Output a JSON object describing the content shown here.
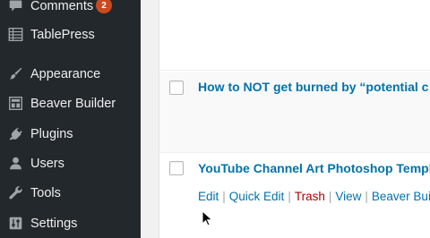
{
  "sidebar": {
    "items": [
      {
        "label": "Comments",
        "icon": "comment-bubble-icon",
        "badge": "2"
      },
      {
        "label": "TablePress",
        "icon": "table-icon"
      },
      {
        "label": "Appearance",
        "icon": "paintbrush-icon"
      },
      {
        "label": "Beaver Builder",
        "icon": "layout-grid-icon"
      },
      {
        "label": "Plugins",
        "icon": "plugin-plug-icon"
      },
      {
        "label": "Users",
        "icon": "user-icon"
      },
      {
        "label": "Tools",
        "icon": "wrench-icon"
      },
      {
        "label": "Settings",
        "icon": "settings-sliders-icon"
      }
    ]
  },
  "posts": [
    {
      "title": "How to NOT get burned by “potential c"
    },
    {
      "title": "YouTube Channel Art Photoshop Templ",
      "actions": {
        "edit": "Edit",
        "quick_edit": "Quick Edit",
        "trash": "Trash",
        "view": "View",
        "builder": "Beaver Build",
        "separator": "|"
      }
    }
  ],
  "colors": {
    "sidebar_bg": "#23282d",
    "link": "#0073aa",
    "trash": "#aa0000",
    "badge": "#ca4a1f"
  }
}
